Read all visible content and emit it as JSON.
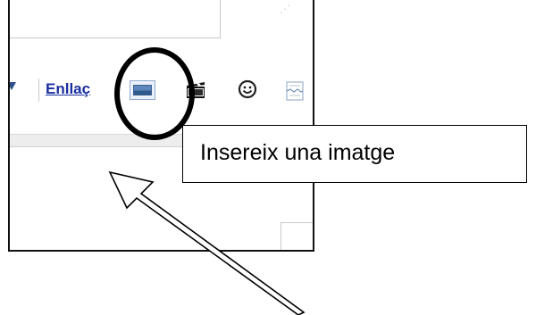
{
  "toolbar": {
    "link_label": "Enllaç",
    "buttons": [
      {
        "icon": "image-icon"
      },
      {
        "icon": "video-clapper-icon"
      },
      {
        "icon": "smiley-icon"
      },
      {
        "icon": "page-break-icon"
      }
    ]
  },
  "tooltip": {
    "text": "Insereix una imatge"
  },
  "annotation": {
    "circle_color": "#000000",
    "arrow_color": "#000000"
  },
  "colors": {
    "link": "#1a2fa0",
    "accent": "#2e4f88"
  }
}
